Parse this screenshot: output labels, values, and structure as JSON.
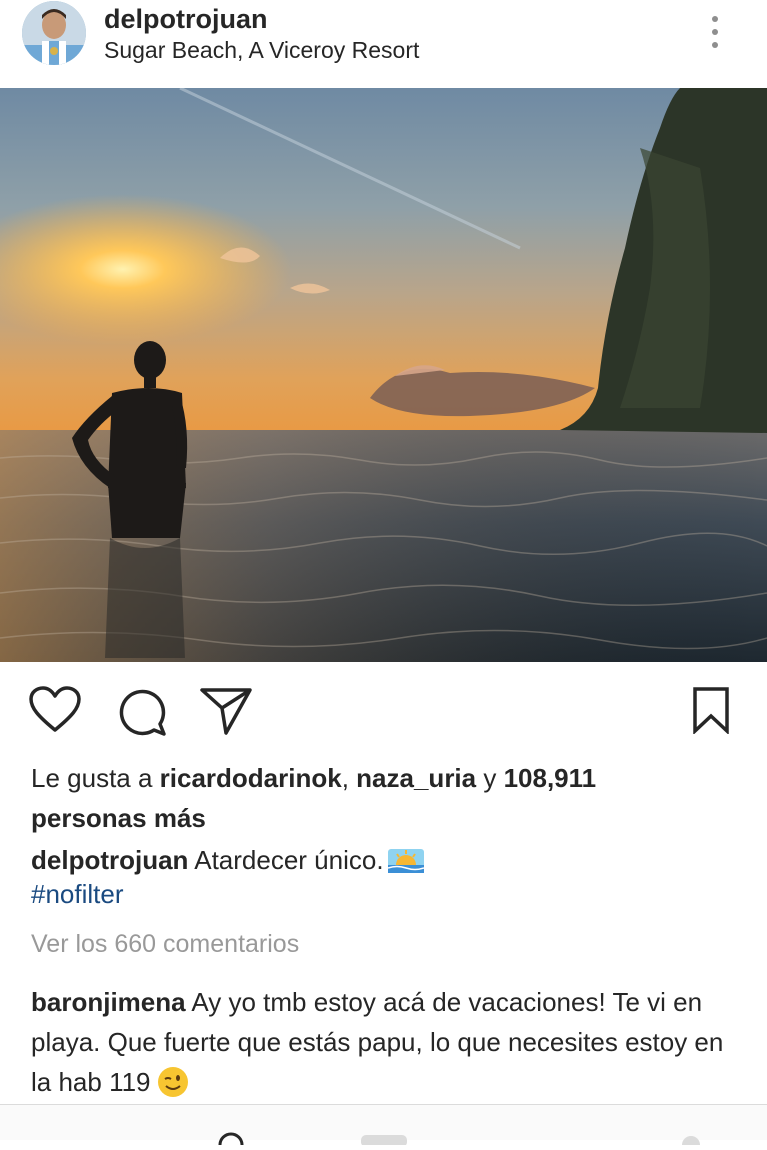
{
  "post": {
    "username": "delpotrojuan",
    "location": "Sugar Beach, A Viceroy Resort"
  },
  "icons": {
    "more": "more-vertical-icon",
    "like": "heart-icon",
    "comment": "comment-icon",
    "share": "send-icon",
    "save": "bookmark-icon"
  },
  "likes": {
    "prefix": "Le gusta a ",
    "user1": "ricardodarinok",
    "separator": ", ",
    "user2": "naza_uria",
    "conjunction": " y ",
    "count": "108,911",
    "suffix": "personas más"
  },
  "caption": {
    "username": "delpotrojuan",
    "text": "Atardecer único.",
    "emoji": "sunrise-emoji",
    "hashtag": "#nofilter"
  },
  "comments": {
    "view_all": "Ver los 660 comentarios",
    "items": [
      {
        "username": "baronjimena",
        "text": "Ay yo tmb estoy acá de vacaciones! Te vi en playa. Que fuerte que estás papu, lo que necesites estoy en la hab 119",
        "emoji": "wink-emoji"
      }
    ]
  },
  "colors": {
    "text": "#262626",
    "hashtag": "#1a4a80",
    "muted": "#999999"
  }
}
